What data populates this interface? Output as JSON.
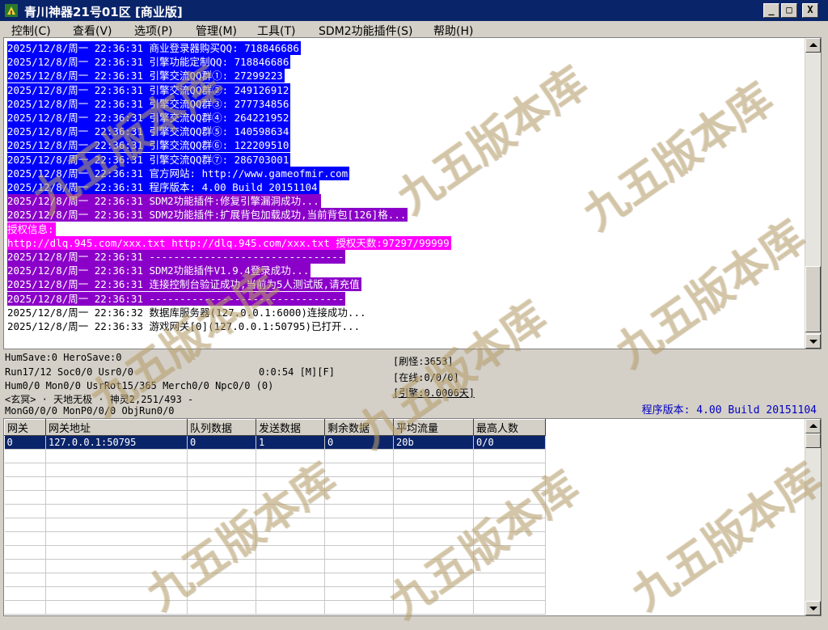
{
  "window": {
    "title": "青川神器21号01区 [商业版]",
    "buttons": [
      "_",
      "□",
      "X"
    ]
  },
  "menu": [
    {
      "label": "控制(C)"
    },
    {
      "label": "查看(V)"
    },
    {
      "label": "选项(P)"
    },
    {
      "label": "管理(M)"
    },
    {
      "label": "工具(T)"
    },
    {
      "label": "SDM2功能插件(S)"
    },
    {
      "label": "帮助(H)"
    }
  ],
  "log": [
    {
      "text": "2025/12/8/周一 22:36:31 商业登录器购买QQ: 718846686",
      "bg": "#0000ff",
      "fg": "#ffffff"
    },
    {
      "text": "2025/12/8/周一 22:36:31 引擎功能定制QQ: 718846686",
      "bg": "#0000ff",
      "fg": "#ffffff"
    },
    {
      "text": "2025/12/8/周一 22:36:31 引擎交流QQ群①: 27299223",
      "bg": "#0000ff",
      "fg": "#ffffff"
    },
    {
      "text": "2025/12/8/周一 22:36:31 引擎交流QQ群②: 249126912",
      "bg": "#0000ff",
      "fg": "#ffffff"
    },
    {
      "text": "2025/12/8/周一 22:36:31 引擎交流QQ群③: 277734856",
      "bg": "#0000ff",
      "fg": "#ffffff"
    },
    {
      "text": "2025/12/8/周一 22:36:31 引擎交流QQ群④: 264221952",
      "bg": "#0000ff",
      "fg": "#ffffff"
    },
    {
      "text": "2025/12/8/周一 22:36:31 引擎交流QQ群⑤: 140598634",
      "bg": "#0000ff",
      "fg": "#ffffff"
    },
    {
      "text": "2025/12/8/周一 22:36:31 引擎交流QQ群⑥: 122209510",
      "bg": "#0000ff",
      "fg": "#ffffff"
    },
    {
      "text": "2025/12/8/周一 22:36:31 引擎交流QQ群⑦: 286703001",
      "bg": "#0000ff",
      "fg": "#ffffff"
    },
    {
      "text": "2025/12/8/周一 22:36:31 官方网站: http://www.gameofmir.com",
      "bg": "#0000ff",
      "fg": "#ffffff"
    },
    {
      "text": "2025/12/8/周一 22:36:31 程序版本: 4.00 Build 20151104",
      "bg": "#0000ff",
      "fg": "#ffffff"
    },
    {
      "text": "2025/12/8/周一 22:36:31 SDM2功能插件:修复引擎漏洞成功...",
      "bg": "#8b00c8",
      "fg": "#ffffff"
    },
    {
      "text": "2025/12/8/周一 22:36:31 SDM2功能插件:扩展背包加载成功,当前背包[126]格...",
      "bg": "#8b00c8",
      "fg": "#ffffff"
    },
    {
      "text": "授权信息:",
      "bg": "#ff00ff",
      "fg": "#ffffff"
    },
    {
      "text": "http://dlq.945.com/xxx.txt http://dlq.945.com/xxx.txt 授权天数:97297/99999",
      "bg": "#ff00ff",
      "fg": "#ffffff"
    },
    {
      "text": "2025/12/8/周一 22:36:31 --------------------------------",
      "bg": "#8b00c8",
      "fg": "#ffffff"
    },
    {
      "text": "2025/12/8/周一 22:36:31 SDM2功能插件V1.9.4登录成功...",
      "bg": "#8b00c8",
      "fg": "#ffffff"
    },
    {
      "text": "2025/12/8/周一 22:36:31 连接控制台验证成功,当前为5人测试版,请充值",
      "bg": "#8b00c8",
      "fg": "#ffffff"
    },
    {
      "text": "2025/12/8/周一 22:36:31 --------------------------------",
      "bg": "#8b00c8",
      "fg": "#ffffff"
    },
    {
      "text": "2025/12/8/周一 22:36:32 数据库服务器(127.0.0.1:6000)连接成功...",
      "bg": "transparent",
      "fg": "#000000"
    },
    {
      "text": "2025/12/8/周一 22:36:33 游戏网关[0](127.0.0.1:50795)已打开...",
      "bg": "transparent",
      "fg": "#000000"
    }
  ],
  "stats": {
    "line1": "HumSave:0 HeroSave:0",
    "line2a": "Run17/12 Soc0/0 Usr0/0",
    "line2b": "0:0:54 [M][F]",
    "line3": "Hum0/0 Mon0/0 UsrRot15/365 Merch0/0 Npc0/0 (0)",
    "line4": "<玄冥> · 天地无极 · 神灵2,251/493 -",
    "line5": "MonG0/0/0 MonP0/0/0 ObjRun0/0",
    "refresh": "[刷怪:3653]",
    "online": "[在线:0/0/0]",
    "engine": "[引擎:0.0006天]",
    "version": "程序版本: 4.00 Build 20151104"
  },
  "gateway_table": {
    "columns": [
      "网关",
      "网关地址",
      "队列数据",
      "发送数据",
      "剩余数据",
      "平均流量",
      "最高人数"
    ],
    "rows": [
      [
        "0",
        "127.0.0.1:50795",
        "0",
        "1",
        "0",
        "20b",
        "0/0"
      ]
    ]
  },
  "watermark": {
    "text": "九五版本库",
    "url": "www.95bbk.com"
  }
}
